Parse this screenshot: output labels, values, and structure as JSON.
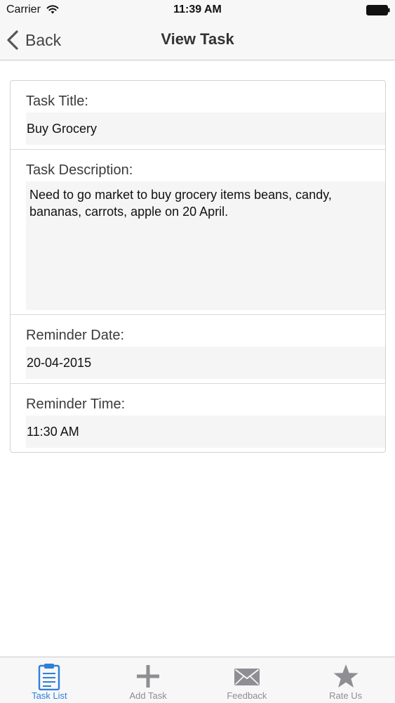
{
  "status_bar": {
    "carrier": "Carrier",
    "time": "11:39 AM"
  },
  "nav_bar": {
    "back_label": "Back",
    "title": "View Task"
  },
  "task": {
    "title_label": "Task Title:",
    "title_value": "Buy Grocery",
    "description_label": "Task Description:",
    "description_value": "Need to go market to buy grocery items beans, candy, bananas, carrots, apple on 20 April.",
    "reminder_date_label": "Reminder Date:",
    "reminder_date_value": "20-04-2015",
    "reminder_time_label": "Reminder Time:",
    "reminder_time_value": "11:30 AM"
  },
  "tab_bar": {
    "items": [
      {
        "label": "Task List",
        "icon": "clipboard-icon",
        "active": true
      },
      {
        "label": "Add Task",
        "icon": "plus-icon",
        "active": false
      },
      {
        "label": "Feedback",
        "icon": "envelope-icon",
        "active": false
      },
      {
        "label": "Rate Us",
        "icon": "star-icon",
        "active": false
      }
    ]
  },
  "colors": {
    "accent": "#2f7fd6",
    "inactive": "#8e8e93",
    "bar_background": "#f7f7f8"
  }
}
